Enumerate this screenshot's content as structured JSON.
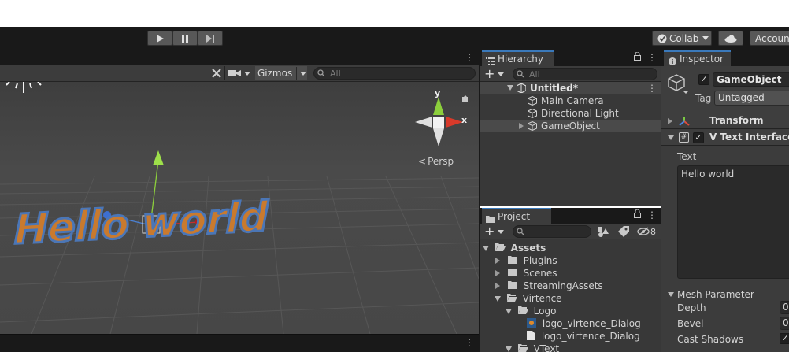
{
  "toolbar": {
    "collab_label": "Collab",
    "account_label": "Accoun"
  },
  "scene": {
    "gizmos_label": "Gizmos",
    "search_placeholder": "All",
    "persp_label": "Persp",
    "axis_x": "x",
    "axis_y": "y",
    "text_3d": "Hello world"
  },
  "hierarchy": {
    "tab_label": "Hierarchy",
    "search_placeholder": "All",
    "scene_name": "Untitled*",
    "items": [
      {
        "label": "Main Camera"
      },
      {
        "label": "Directional Light"
      },
      {
        "label": "GameObject"
      }
    ]
  },
  "project": {
    "tab_label": "Project",
    "hidden_count": "8",
    "tree": [
      {
        "label": "Assets",
        "kind": "folder-open"
      },
      {
        "label": "Plugins",
        "kind": "folder"
      },
      {
        "label": "Scenes",
        "kind": "folder"
      },
      {
        "label": "StreamingAssets",
        "kind": "folder"
      },
      {
        "label": "Virtence",
        "kind": "folder-open"
      },
      {
        "label": "Logo",
        "kind": "folder-open"
      },
      {
        "label": "logo_virtence_Dialog",
        "kind": "image"
      },
      {
        "label": "logo_virtence_Dialog",
        "kind": "file"
      },
      {
        "label": "VText",
        "kind": "folder-open"
      }
    ]
  },
  "inspector": {
    "tab_label": "Inspector",
    "object_name": "GameObject",
    "tag_label": "Tag",
    "tag_value": "Untagged",
    "transform_label": "Transform",
    "component_label": "V Text Interface (",
    "text_field_label": "Text",
    "text_value": "Hello world",
    "mesh_section_label": "Mesh Parameter",
    "depth_label": "Depth",
    "depth_value": "0",
    "bevel_label": "Bevel",
    "bevel_value": "0",
    "cast_shadows_label": "Cast Shadows"
  },
  "colors": {
    "accent": "#3a79bb",
    "panel": "#3c3c3c",
    "dark": "#191919",
    "text_orange": "#c97a2e",
    "text_outline": "#4b76b6"
  }
}
